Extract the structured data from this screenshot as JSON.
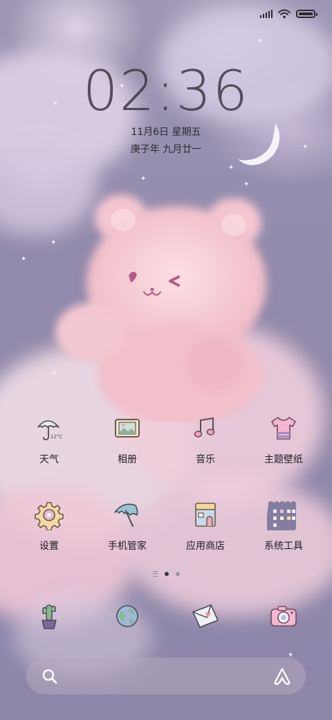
{
  "status_bar": {
    "icons": [
      "signal-icon",
      "wifi-icon",
      "battery-icon"
    ]
  },
  "lock": {
    "time": "02:36",
    "date": "11月6日 星期五",
    "lunar_date": "庚子年 九月廿一"
  },
  "apps": [
    {
      "label": "天气",
      "icon": "weather-umbrella-icon"
    },
    {
      "label": "相册",
      "icon": "gallery-icon"
    },
    {
      "label": "音乐",
      "icon": "music-note-icon"
    },
    {
      "label": "主题壁纸",
      "icon": "theme-tshirt-icon"
    },
    {
      "label": "设置",
      "icon": "settings-gear-icon"
    },
    {
      "label": "手机管家",
      "icon": "security-umbrella-icon"
    },
    {
      "label": "应用商店",
      "icon": "app-store-house-icon"
    },
    {
      "label": "系统工具",
      "icon": "system-tools-folder-icon"
    }
  ],
  "weather_icon_text": "12°C",
  "dock": [
    {
      "icon": "phone-cactus-icon"
    },
    {
      "icon": "browser-globe-icon"
    },
    {
      "icon": "messages-envelope-icon"
    },
    {
      "icon": "camera-icon"
    }
  ],
  "page_indicator": {
    "pages": 2,
    "current": 1
  },
  "search": {
    "left_icon": "search-icon",
    "right_icon": "assistant-icon"
  },
  "colors": {
    "clock_text": "#3c3744",
    "label_text": "#1e1b24",
    "bear_pink": "#f3c3cc",
    "sky_purple": "#8f87a8"
  }
}
